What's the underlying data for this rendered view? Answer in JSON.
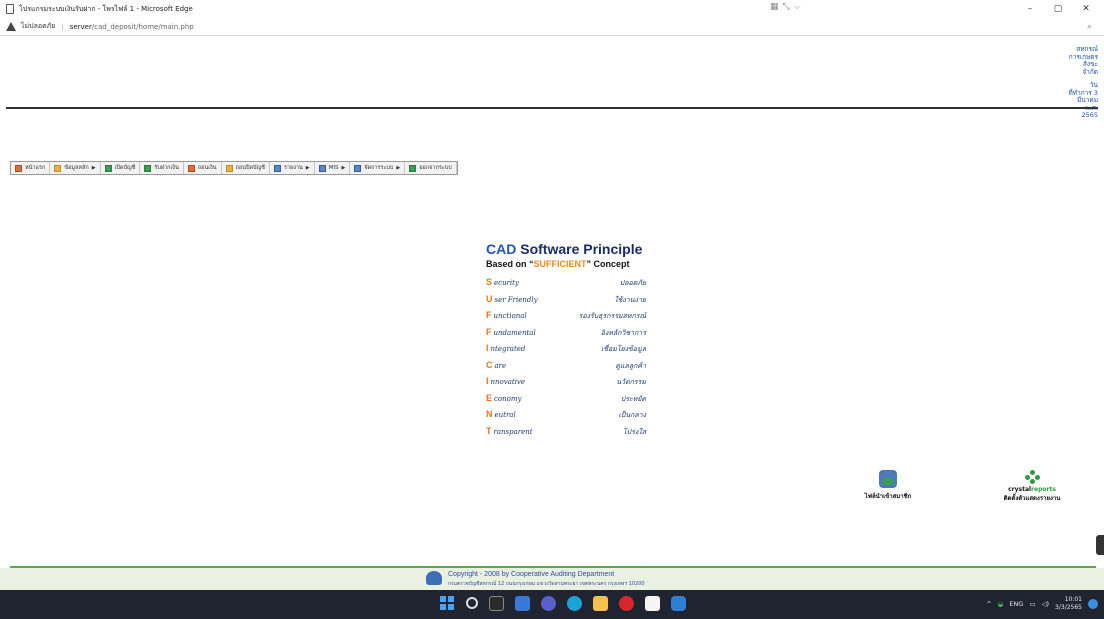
{
  "window": {
    "title": "โปรแกรมระบบเงินรับฝาก - โพรไฟล์ 1 - Microsoft Edge",
    "minimize": "–",
    "maximize": "▢",
    "close": "✕"
  },
  "address_bar": {
    "security_text": "ไม่ปลอดภัย",
    "url_host": "server",
    "url_path": "/cad_deposit/home/main.php"
  },
  "header_info": {
    "lines": [
      "สหกรณ์",
      "การเกษตร",
      "สังขะ",
      "จำกัด",
      "",
      "วัน",
      "ที่ทำการ 3",
      "มีนาคม",
      "พ.ศ.",
      "2565"
    ]
  },
  "menu": {
    "items": [
      {
        "label": "หน้าแรก",
        "icon": "home-icon",
        "has_arrow": false
      },
      {
        "label": "ข้อมูลหลัก",
        "icon": "folder-icon",
        "has_arrow": true
      },
      {
        "label": "เปิดบัญชี",
        "icon": "book-icon",
        "has_arrow": false
      },
      {
        "label": "รับฝากเงิน",
        "icon": "deposit-icon",
        "has_arrow": false
      },
      {
        "label": "ถอนเงิน",
        "icon": "withdraw-icon",
        "has_arrow": false
      },
      {
        "label": "ถอนปิดบัญชี",
        "icon": "close-account-icon",
        "has_arrow": false
      },
      {
        "label": "รายงาน",
        "icon": "report-icon",
        "has_arrow": true
      },
      {
        "label": "MIS",
        "icon": "mis-icon",
        "has_arrow": true
      },
      {
        "label": "จัดการระบบ",
        "icon": "settings-icon",
        "has_arrow": true
      },
      {
        "label": "ออกจากระบบ",
        "icon": "logout-icon",
        "has_arrow": false
      }
    ]
  },
  "principle": {
    "title_cad": "CAD",
    "title_rest": " Software Principle",
    "sub_prefix": "Based on ",
    "sub_open_quote": "“",
    "sub_highlight": "SUFFICIENT",
    "sub_close_quote": "”",
    "sub_suffix": " Concept",
    "rows": [
      {
        "letter": "S",
        "word": "ecurity",
        "thai": "ปลอดภัย"
      },
      {
        "letter": "U",
        "word": "ser Friendly",
        "thai": "ใช้งานง่าย"
      },
      {
        "letter": "F",
        "word": "unctional",
        "thai": "รองรับธุรกรรมสหกรณ์"
      },
      {
        "letter": "F",
        "word": "undamental",
        "thai": "อิงหลักวิชาการ"
      },
      {
        "letter": "I",
        "word": "ntegrated",
        "thai": "เชื่อมโยงข้อมูล"
      },
      {
        "letter": "C",
        "word": "are",
        "thai": "ดูแลลูกค้า"
      },
      {
        "letter": "I",
        "word": "nnovative",
        "thai": "นวัตกรรม"
      },
      {
        "letter": "E",
        "word": "conomy",
        "thai": "ประหยัด"
      },
      {
        "letter": "N",
        "word": "eutral",
        "thai": "เป็นกลาง"
      },
      {
        "letter": "T",
        "word": "ransparent",
        "thai": "โปร่งใส"
      }
    ]
  },
  "shortcuts": {
    "members_label": "ไฟล์นำเข้าสมาชิก",
    "crystal_brand": "crystal",
    "crystal_brand2": "reports",
    "crystal_label": "ติดตั้งตัวแสดงรายงาน"
  },
  "footer": {
    "copyright": "Copyright - 2008 by Cooperative Auditing Department",
    "address": "กรมตรวจบัญชีสหกรณ์ 12 ถนนกรุงเกษม แขวงวัดสามพระยา เขตพระนคร กรุงเทพฯ 10200"
  },
  "taskbar": {
    "lang": "ENG",
    "time": "10:01",
    "date": "3/3/2565"
  },
  "colors": {
    "accent_blue": "#1f56b8",
    "accent_orange": "#e8751a",
    "footer_green": "#5da84a"
  }
}
